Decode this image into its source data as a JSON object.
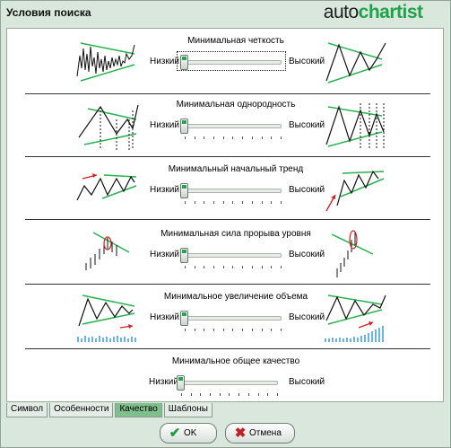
{
  "window": {
    "title": "Условия поиска"
  },
  "brand": {
    "part1": "auto",
    "part2": "chartist",
    "tm": "™",
    "accent": "#1fa34a"
  },
  "sections": [
    {
      "title": "Минимальная четкость",
      "low": "Низкий",
      "high": "Высокий",
      "value": 0,
      "focused": true
    },
    {
      "title": "Минимальная однородность",
      "low": "Низкий",
      "high": "Высокий",
      "value": 0,
      "focused": false
    },
    {
      "title": "Минимальный начальный тренд",
      "low": "Низкий",
      "high": "Высокий",
      "value": 0,
      "focused": false
    },
    {
      "title": "Минимальная сила прорыва уровня",
      "low": "Низкий",
      "high": "Высокий",
      "value": 0,
      "focused": false
    },
    {
      "title": "Минимальное увеличение объема",
      "low": "Низкий",
      "high": "Высокий",
      "value": 0,
      "focused": false
    },
    {
      "title": "Минимальное общее качество",
      "low": "Низкий",
      "high": "Высокий",
      "value": 0,
      "focused": false
    }
  ],
  "tabs": [
    {
      "label": "Символ",
      "active": false
    },
    {
      "label": "Особенности",
      "active": false
    },
    {
      "label": "Качество",
      "active": true
    },
    {
      "label": "Шаблоны",
      "active": false
    }
  ],
  "buttons": {
    "ok": "OK",
    "cancel": "Отмена"
  },
  "icons": {
    "ok": "check-icon",
    "cancel": "x-icon"
  }
}
